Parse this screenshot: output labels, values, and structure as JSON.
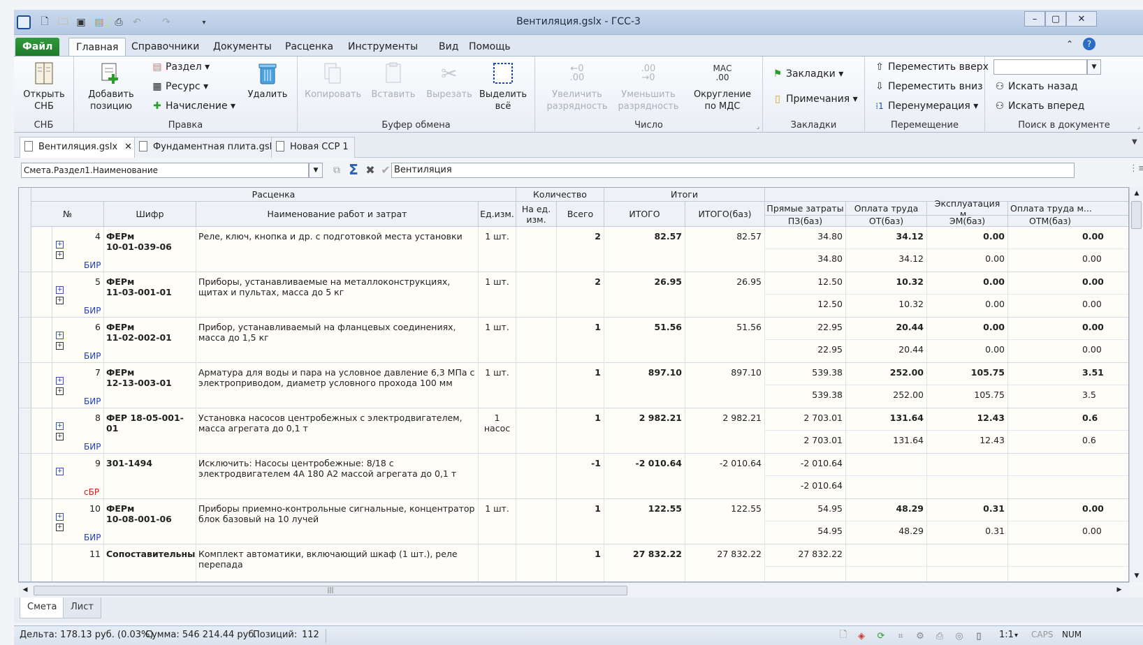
{
  "window": {
    "title": "Вентиляция.gslx - ГСС-3"
  },
  "ribbon_tabs": [
    "Файл",
    "Главная",
    "Справочники",
    "Документы",
    "Расценка",
    "Инструменты",
    "Вид",
    "Помощь"
  ],
  "ribbon": {
    "snb": {
      "btn": "Открыть СНБ",
      "group": "СНБ"
    },
    "edit": {
      "add": "Добавить позицию",
      "razdel": "Раздел",
      "resurs": "Ресурс",
      "nachislenie": "Начисление",
      "delete": "Удалить",
      "group": "Правка"
    },
    "clipboard": {
      "copy": "Копировать",
      "paste": "Вставить",
      "cut": "Вырезать",
      "select_all": "Выделить всё",
      "group": "Буфер обмена"
    },
    "number": {
      "inc": "Увеличить разрядность",
      "dec": "Уменьшить разрядность",
      "round": "Округление по МДС",
      "inc_icon": "←0 .00",
      "dec_icon": ".00 →0",
      "round_icon": "МАС .00",
      "group": "Число"
    },
    "bookmarks": {
      "bm": "Закладки",
      "notes": "Примечания",
      "group": "Закладки"
    },
    "move": {
      "up": "Переместить вверх",
      "down": "Переместить вниз",
      "renum": "Перенумерация",
      "group": "Перемещение"
    },
    "search": {
      "back": "Искать назад",
      "forward": "Искать вперед",
      "group": "Поиск в документе",
      "placeholder": ""
    }
  },
  "doc_tabs": [
    "Вентиляция.gslx",
    "Фундаментная плита.gslx",
    "Новая ССР 1"
  ],
  "formula_bar": {
    "name": "Смета.Раздел1.Наименование",
    "value": "Вентиляция"
  },
  "grid": {
    "group_headers": {
      "rascenka": "Расценка",
      "kolichestvo": "Количество",
      "itogi": "Итоги"
    },
    "headers": {
      "num": "№",
      "shifr": "Шифр",
      "name": "Наименование работ и затрат",
      "unit": "Ед.изм.",
      "per_unit": "На ед. изм.",
      "total": "Всего",
      "itogo": "ИТОГО",
      "itogo_baz": "ИТОГО(баз)",
      "pz_top": "Прямые затраты",
      "pz_bot": "ПЗ(баз)",
      "ot_top": "Оплата труда",
      "ot_bot": "ОТ(баз)",
      "em_top": "Эксплуатация м...",
      "em_bot": "ЭМ(баз)",
      "otm_top": "Оплата труда м...",
      "otm_bot": "ОТМ(баз)"
    },
    "rows": [
      {
        "num": "4",
        "code1": "ФЕРм",
        "code2": "10-01-039-06",
        "name": "Реле, ключ, кнопка и др. с подготовкой места установки",
        "unit": "1 шт.",
        "qty": "2",
        "itogo": "82.57",
        "itogo_baz": "82.57",
        "pz": "34.80",
        "pz2": "34.80",
        "ot": "34.12",
        "ot2": "34.12",
        "em": "0.00",
        "em2": "0.00",
        "otm": "0.00",
        "otm2": "0.00",
        "tag": "БИР"
      },
      {
        "num": "5",
        "code1": "ФЕРм",
        "code2": "11-03-001-01",
        "name": "Приборы, устанавливаемые на металлоконструкциях, щитах и пультах, масса до 5 кг",
        "unit": "1 шт.",
        "qty": "2",
        "itogo": "26.95",
        "itogo_baz": "26.95",
        "pz": "12.50",
        "pz2": "12.50",
        "ot": "10.32",
        "ot2": "10.32",
        "em": "0.00",
        "em2": "0.00",
        "otm": "0.00",
        "otm2": "0.00",
        "tag": "БИР"
      },
      {
        "num": "6",
        "code1": "ФЕРм",
        "code2": "11-02-002-01",
        "name": "Прибор, устанавливаемый на фланцевых соединениях, масса до 1,5 кг",
        "unit": "1 шт.",
        "qty": "1",
        "itogo": "51.56",
        "itogo_baz": "51.56",
        "pz": "22.95",
        "pz2": "22.95",
        "ot": "20.44",
        "ot2": "20.44",
        "em": "0.00",
        "em2": "0.00",
        "otm": "0.00",
        "otm2": "0.00",
        "tag": "БИР"
      },
      {
        "num": "7",
        "code1": "ФЕРм",
        "code2": "12-13-003-01",
        "name": "Арматура для воды и пара на условное давление 6,3 МПа с электроприводом, диаметр условного прохода 100 мм",
        "unit": "1 шт.",
        "qty": "1",
        "itogo": "897.10",
        "itogo_baz": "897.10",
        "pz": "539.38",
        "pz2": "539.38",
        "ot": "252.00",
        "ot2": "252.00",
        "em": "105.75",
        "em2": "105.75",
        "otm": "3.51",
        "otm2": "3.5",
        "tag": "БИР"
      },
      {
        "num": "8",
        "code1": "ФЕР 18-05-001-01",
        "code2": "",
        "name": "Установка насосов центробежных с электродвигателем, масса агрегата до 0,1 т",
        "unit": "1 насос",
        "qty": "1",
        "itogo": "2 982.21",
        "itogo_baz": "2 982.21",
        "pz": "2 703.01",
        "pz2": "2 703.01",
        "ot": "131.64",
        "ot2": "131.64",
        "em": "12.43",
        "em2": "12.43",
        "otm": "0.6",
        "otm2": "0.6",
        "tag": "БИР"
      },
      {
        "num": "9",
        "code1": "301-1494",
        "code2": "",
        "name": "Исключить: Насосы центробежные: 8/18 с электродвигателем 4А 180 А2 массой агрегата до 0,1 т",
        "unit": "",
        "qty": "-1",
        "itogo": "-2 010.64",
        "itogo_baz": "-2 010.64",
        "pz": "-2 010.64",
        "pz2": "-2 010.64",
        "ot": "",
        "ot2": "",
        "em": "",
        "em2": "",
        "otm": "",
        "otm2": "",
        "tag": "сБР"
      },
      {
        "num": "10",
        "code1": "ФЕРм",
        "code2": "10-08-001-06",
        "name": "Приборы приемно-контрольные сигнальные, концентратор блок базовый на 10 лучей",
        "unit": "1 шт.",
        "qty": "1",
        "itogo": "122.55",
        "itogo_baz": "122.55",
        "pz": "54.95",
        "pz2": "54.95",
        "ot": "48.29",
        "ot2": "48.29",
        "em": "0.31",
        "em2": "0.31",
        "otm": "0.00",
        "otm2": "0.00",
        "tag": "БИР"
      },
      {
        "num": "11",
        "code1": "Сопоставительны",
        "code2": "",
        "name": "Комплект автоматики, включающий шкаф (1 шт.), реле перепада",
        "unit": "",
        "qty": "1",
        "itogo": "27 832.22",
        "itogo_baz": "27 832.22",
        "pz": "27 832.22",
        "pz2": "",
        "ot": "",
        "ot2": "",
        "em": "",
        "em2": "",
        "otm": "",
        "otm2": "",
        "tag": ""
      }
    ]
  },
  "sheet_tabs": [
    "Смета",
    "Лист"
  ],
  "status": {
    "delta": "Дельта: 178.13 руб. (0.03%)",
    "sum": "Сумма: 546 214.44 руб.",
    "positions_label": "Позиций:",
    "positions": "112",
    "zoom": "1:1",
    "caps": "CAPS",
    "num": "NUM"
  },
  "colors": {
    "accent": "#1f7a2b",
    "grid_bg": "#fffdf7",
    "link_blue": "#1f3fbf",
    "red_tag": "#d11c1c"
  }
}
